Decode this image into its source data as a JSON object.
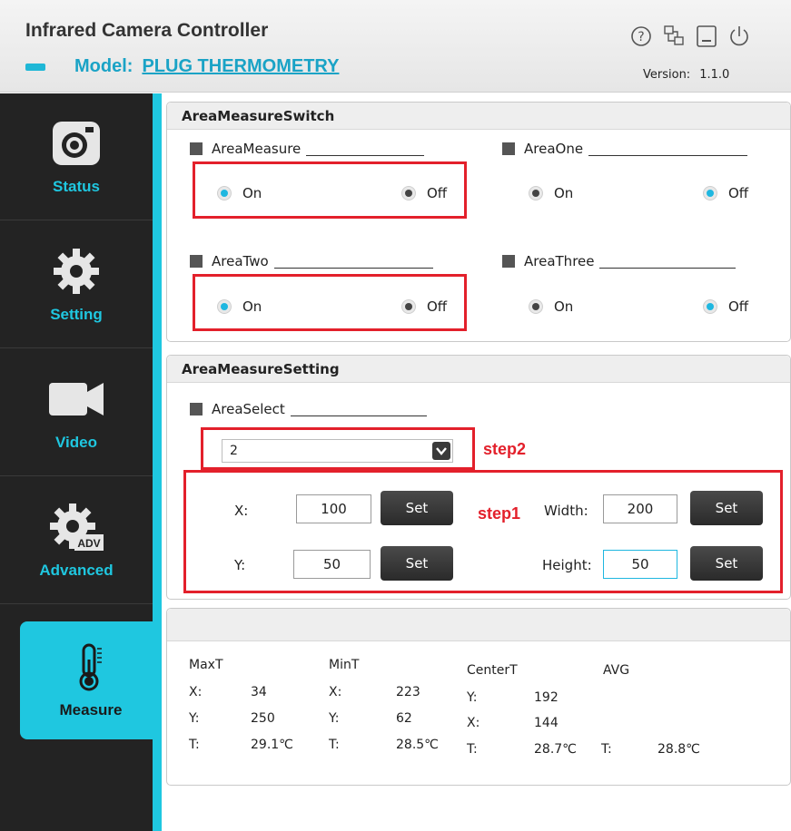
{
  "header": {
    "title": "Infrared Camera Controller",
    "model_label": "Model:",
    "model_value": "PLUG THERMOMETRY",
    "version_label": "Version:",
    "version_value": "1.1.0",
    "icons": [
      "help-icon",
      "network-icon",
      "minimize-icon",
      "power-icon"
    ]
  },
  "sidebar": {
    "items": [
      {
        "label": "Status",
        "icon": "camera-icon"
      },
      {
        "label": "Setting",
        "icon": "gear-icon"
      },
      {
        "label": "Video",
        "icon": "video-camera-icon"
      },
      {
        "label": "Advanced",
        "icon": "gear-adv-icon",
        "icon_text": "ADV"
      },
      {
        "label": "Measure",
        "icon": "thermometer-icon",
        "active": true
      }
    ]
  },
  "switch_panel": {
    "title": "AreaMeasureSwitch",
    "groups": [
      {
        "label": "AreaMeasure",
        "on": "On",
        "off": "Off",
        "selected": "On"
      },
      {
        "label": "AreaOne",
        "on": "On",
        "off": "Off",
        "selected": "Off"
      },
      {
        "label": "AreaTwo",
        "on": "On",
        "off": "Off",
        "selected": "On"
      },
      {
        "label": "AreaThree",
        "on": "On",
        "off": "Off",
        "selected": "Off"
      }
    ]
  },
  "setting_panel": {
    "title": "AreaMeasureSetting",
    "area_select_label": "AreaSelect",
    "area_select_value": "2",
    "step2": "step2",
    "step1": "step1",
    "x_label": "X:",
    "x_value": "100",
    "y_label": "Y:",
    "y_value": "50",
    "width_label": "Width:",
    "width_value": "200",
    "height_label": "Height:",
    "height_value": "50",
    "set_label": "Set"
  },
  "results_panel": {
    "maxt": {
      "title": "MaxT",
      "x_label": "X:",
      "x": "34",
      "y_label": "Y:",
      "y": "250",
      "t_label": "T:",
      "t": "29.1℃"
    },
    "mint": {
      "title": "MinT",
      "x_label": "X:",
      "x": "223",
      "y_label": "Y:",
      "y": "62",
      "t_label": "T:",
      "t": "28.5℃"
    },
    "centert": {
      "title": "CenterT",
      "y_label": "Y:",
      "y": "192",
      "x_label": "X:",
      "x": "144",
      "t_label": "T:",
      "t": "28.7℃"
    },
    "avg": {
      "title": "AVG",
      "t_label": "T:",
      "t": "28.8℃"
    }
  },
  "colors": {
    "accent": "#1fc7e0",
    "sidebar": "#232323",
    "highlight": "#e3202b"
  }
}
